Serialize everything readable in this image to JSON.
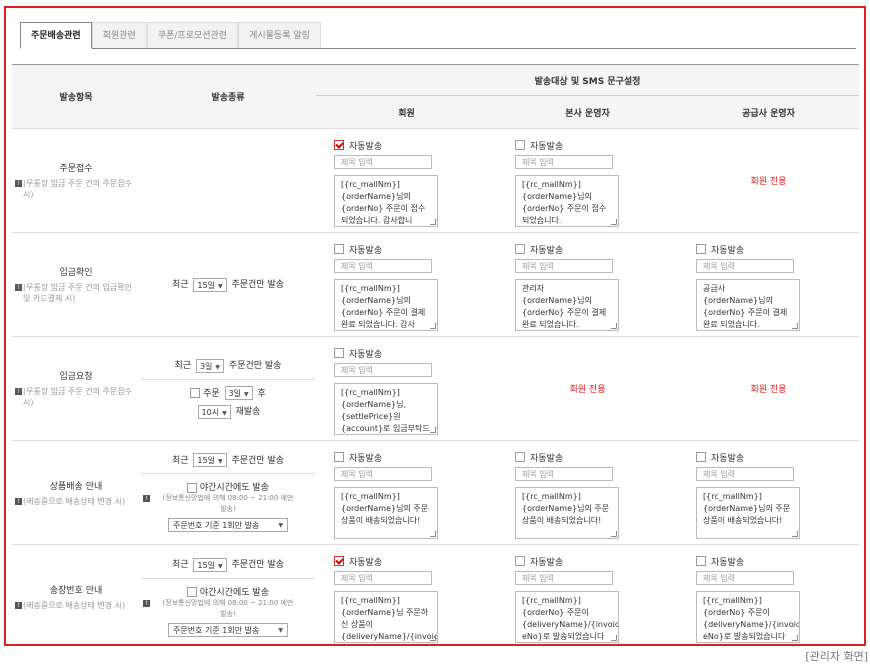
{
  "tabs": [
    {
      "label": "주문배송관련",
      "active": true
    },
    {
      "label": "회원관련"
    },
    {
      "label": "쿠폰/프로모션관련"
    },
    {
      "label": "게시물등록 알림"
    }
  ],
  "header": {
    "item": "발송항목",
    "kind": "발송종류",
    "target": "발송대상 및 SMS 문구설정",
    "member": "회원",
    "hq": "본사 운영자",
    "supplier": "공급사 운영자"
  },
  "common": {
    "auto": "자동발송",
    "subject_ph": "제목 입력",
    "member_only": "회원 전용"
  },
  "rows": [
    {
      "title": "주문접수",
      "note": "(무통장 입금 주문 건의 주문접수 시)",
      "member": {
        "checked": true,
        "msg": "[{rc_mallNm}]\n{orderName}님의\n{orderNo} 주문이 접수\n되었습니다. 감사합니"
      },
      "hq": {
        "checked": false,
        "msg": "[{rc_mallNm}]\n{orderName}님의\n{orderNo} 주문이 접수\n되었습니다."
      }
    },
    {
      "title": "입금확인",
      "note": "(무통장 입금 주문 건의 입금확인 및 카드결제 시)",
      "kind": {
        "pre": "최근",
        "sel": "15일",
        "post": "주문건만 발송"
      },
      "member": {
        "checked": false,
        "msg": "[{rc_mallNm}]\n{orderName}님의\n{orderNo} 주문이 결제\n완료 되었습니다. 감사"
      },
      "hq": {
        "checked": false,
        "msg": "관리자\n{orderName}님의\n{orderNo} 주문이 결제\n완료 되었습니다."
      },
      "supplier": {
        "checked": false,
        "msg": "공급사\n{orderName}님의\n{orderNo} 주문이 결제\n완료 되었습니다."
      }
    },
    {
      "title": "입금요청",
      "note": "(무통장 입금 주문 건의 주문접수 시)",
      "kind": {
        "pre": "최근",
        "sel": "3일",
        "post": "주문건만 발송",
        "pre2": "주문",
        "sel2": "3일",
        "post2": "후",
        "sel3": "10시",
        "post3": "재발송"
      },
      "member": {
        "checked": false,
        "msg": "[{rc_mallNm}]\n{orderName}님,\n{settlePrice}원\n{account}로 입금부탁드"
      }
    },
    {
      "title": "상품배송 안내",
      "note": "(배송중으로 배송상태 변경 시)",
      "kind": {
        "pre": "최근",
        "sel": "15일",
        "post": "주문건만 발송",
        "night": "야간시간에도 발송",
        "law": "(정보통신망법에 의해 08:00 ~ 21:00 에만 발송)",
        "once": "주문번호 기준 1회만 발송"
      },
      "member": {
        "checked": false,
        "msg": "[{rc_mallNm}]\n{orderName}님의 주문\n상품이 배송되었습니다!"
      },
      "hq": {
        "checked": false,
        "msg": "[{rc_mallNm}]\n{orderName}님의 주문\n상품이 배송되었습니다!"
      },
      "supplier": {
        "checked": false,
        "msg": "[{rc_mallNm}]\n{orderName}님의 주문\n상품이 배송되었습니다!"
      }
    },
    {
      "title": "송장번호 안내",
      "note": "(배송중으로 배송상태 변경 시)",
      "kind": {
        "pre": "최근",
        "sel": "15일",
        "post": "주문건만 발송",
        "night": "야간시간에도 발송",
        "law": "(정보통신망법에 의해 08:00 ~ 21:00 에만 발송)",
        "once": "주문번호 기준 1회만 발송"
      },
      "member": {
        "checked": true,
        "msg": "[{rc_mallNm}]\n{orderName}님 주문하\n신 상품이\n{deliveryName}/{invoic"
      },
      "hq": {
        "checked": false,
        "msg": "[{rc_mallNm}]\n{orderNo} 주문이\n{deliveryName}/{invoic\neNo}로 발송되었습니다"
      },
      "supplier": {
        "checked": false,
        "msg": "[{rc_mallNm}]\n{orderNo} 주문이\n{deliveryName}/{invoic\neNo}로 발송되었습니다"
      }
    }
  ],
  "caption": "[관리자 화면]"
}
